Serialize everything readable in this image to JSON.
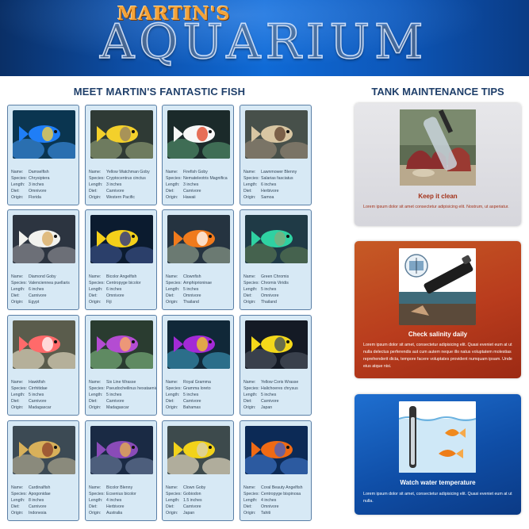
{
  "header": {
    "title_top": "MARTIN'S",
    "title_main": "AQUARIUM"
  },
  "sections": {
    "fish_heading": "MEET MARTIN'S FANTASTIC FISH",
    "tips_heading": "TANK MAINTENANCE TIPS"
  },
  "labels": {
    "name": "Name:",
    "species": "Species:",
    "length": "Length:",
    "diet": "Diet:",
    "origin": "Origin:"
  },
  "fish": [
    {
      "name": "Damselfish",
      "species": "Chrysiptera",
      "length": "3 inches",
      "diet": "Omnivore",
      "origin": "Florida"
    },
    {
      "name": "Yellow Watchman Goby",
      "species": "Cryptocentrus cinctus",
      "length": "3 inches",
      "diet": "Carnivore",
      "origin": "Western Pacific"
    },
    {
      "name": "Firefish Goby",
      "species": "Nemateleotris Magnifica",
      "length": "3 inches",
      "diet": "Carnivore",
      "origin": "Hawaii"
    },
    {
      "name": "Lawnmower Blenny",
      "species": "Salarias fasciatus",
      "length": "6 inches",
      "diet": "Herbivore",
      "origin": "Samoa"
    },
    {
      "name": "Diamond Goby",
      "species": "Valenciennea puellaris",
      "length": "6 inches",
      "diet": "Carnivore",
      "origin": "Egypt"
    },
    {
      "name": "Bicolor Angelfish",
      "species": "Centropyge bicolor",
      "length": "6 inches",
      "diet": "Omnivore",
      "origin": "Fiji"
    },
    {
      "name": "Clownfish",
      "species": "Amphiprioninae",
      "length": "5 inches",
      "diet": "Omnivore",
      "origin": "Thailand"
    },
    {
      "name": "Green Chromis",
      "species": "Chromis Viridis",
      "length": "5 inches",
      "diet": "Omnivore",
      "origin": "Thailand"
    },
    {
      "name": "Hawkfish",
      "species": "Cirrhitidae",
      "length": "5 inches",
      "diet": "Carnivore",
      "origin": "Madagascar"
    },
    {
      "name": "Six Line Wrasse",
      "species": "Pseudocheilinus hexataenia",
      "length": "5 inches",
      "diet": "Carnivore",
      "origin": "Madagascar"
    },
    {
      "name": "Royal Gramma",
      "species": "Gramma loreto",
      "length": "5 inches",
      "diet": "Carnivore",
      "origin": "Bahamas"
    },
    {
      "name": "Yellow Coris Wrasse",
      "species": "Halichoeres chrysus",
      "length": "5 inches",
      "diet": "Carnivore",
      "origin": "Japan"
    },
    {
      "name": "Cardinalfish",
      "species": "Apogonidae",
      "length": "8 inches",
      "diet": "Carnivore",
      "origin": "Indonesia"
    },
    {
      "name": "Bicolor Blenny",
      "species": "Ecsenius bicolor",
      "length": "4 inches",
      "diet": "Herbivore",
      "origin": "Australia"
    },
    {
      "name": "Clown Goby",
      "species": "Gobiodon",
      "length": "1.5 inches",
      "diet": "Carnivore",
      "origin": "Japan"
    },
    {
      "name": "Coral Beauty Angelfish",
      "species": "Centropyge bispinosa",
      "length": "4 inches",
      "diet": "Omnivore",
      "origin": "Tahiti"
    }
  ],
  "tips": [
    {
      "title": "Keep it clean",
      "body": "Lorem ipsum dolor sit amet consectetur adipisicing elit. Nostrum, ut asperiatur."
    },
    {
      "title": "Check salinity daily",
      "body": "Lorem ipsum dolor sit amet, consectetur adipisicing elit. Quasi eveniet eum at ut nulla delectus perferendis aut cum autem neque illo natus voluptatem molestias reprehenderit dicta, tempore facere voluptates provident numquam ipsam. Unde eius atque nisi."
    },
    {
      "title": "Watch water temperature",
      "body": "Lorem ipsum dolor sit amet, consectetur adipisicing elit. Quasi eveniet eum at ut nulla."
    }
  ],
  "colors": {
    "header_blue": "#0f6ad6",
    "title_orange": "#f3a33a",
    "heading_navy": "#1f3f6a",
    "card_bg": "#d7e9f5",
    "card_border": "#5a7fa6",
    "tip_red": "#b93c1d",
    "tip_blue": "#0f4ea7",
    "keep_clean_title": "#a3321a"
  }
}
